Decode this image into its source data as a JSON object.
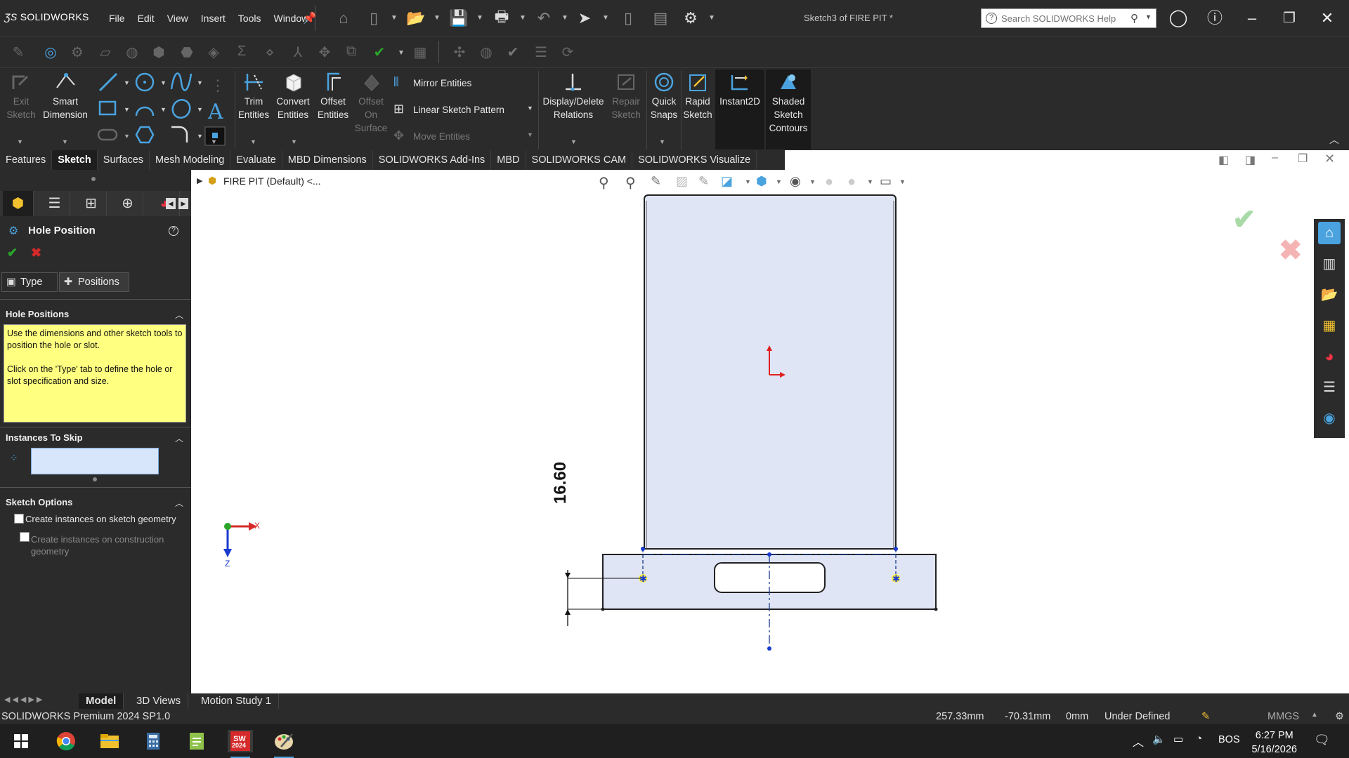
{
  "app": {
    "logo_brand": "SOLIDWORKS",
    "menus": [
      "File",
      "Edit",
      "View",
      "Insert",
      "Tools",
      "Window"
    ],
    "document_title": "Sketch3 of FIRE PIT *",
    "search_placeholder": "Search SOLIDWORKS Help"
  },
  "ribbon": {
    "exit_sketch": [
      "Exit",
      "Sketch"
    ],
    "smart_dimension": [
      "Smart",
      "Dimension"
    ],
    "trim_entities": [
      "Trim",
      "Entities"
    ],
    "convert_entities": [
      "Convert",
      "Entities"
    ],
    "offset_entities": [
      "Offset",
      "Entities"
    ],
    "offset_on_surface": [
      "Offset",
      "On",
      "Surface"
    ],
    "mirror_entities": "Mirror Entities",
    "linear_sketch_pattern": "Linear Sketch Pattern",
    "move_entities": "Move Entities",
    "display_delete_relations": [
      "Display/Delete",
      "Relations"
    ],
    "repair_sketch": [
      "Repair",
      "Sketch"
    ],
    "quick_snaps": [
      "Quick",
      "Snaps"
    ],
    "rapid_sketch": [
      "Rapid",
      "Sketch"
    ],
    "instant2d": "Instant2D",
    "shaded_sketch_contours": [
      "Shaded",
      "Sketch",
      "Contours"
    ]
  },
  "command_tabs": [
    "Features",
    "Sketch",
    "Surfaces",
    "Mesh Modeling",
    "Evaluate",
    "MBD Dimensions",
    "SOLIDWORKS Add-Ins",
    "MBD",
    "SOLIDWORKS CAM",
    "SOLIDWORKS Visualize"
  ],
  "active_tab": "Sketch",
  "property_manager": {
    "title": "Hole Position",
    "help": "?",
    "tab_type": "Type",
    "tab_positions": "Positions",
    "hole_positions_header": "Hole Positions",
    "hint_line1": "Use the dimensions and other sketch tools to position the hole or slot.",
    "hint_line2": "Click on the 'Type' tab to define the hole or slot specification and size.",
    "instances_to_skip_header": "Instances To Skip",
    "sketch_options_header": "Sketch Options",
    "opt_sketch_geometry": "Create instances on sketch geometry",
    "opt_construction_geometry_1": "Create instances on construction",
    "opt_construction_geometry_2": "geometry"
  },
  "feature_tree": {
    "root": "FIRE PIT  (Default) <..."
  },
  "drawing": {
    "dimension_value": "16.60",
    "triad_x": "X",
    "triad_z": "Z"
  },
  "bottom_tabs": [
    "Model",
    "3D Views",
    "Motion Study 1"
  ],
  "status": {
    "product": "SOLIDWORKS Premium 2024 SP1.0",
    "x": "257.33mm",
    "y": "-70.31mm",
    "z": "0mm",
    "state": "Under Defined",
    "units": "MMGS"
  },
  "taskbar": {
    "time": "6:27 PM",
    "date": "5/16/2026",
    "lang": "BOS",
    "sw_year": "2024"
  },
  "colors": {
    "accent_blue": "#1a5fb4",
    "sketch_fill": "#e0e5f6",
    "hint_yellow": "#ffff80",
    "ok_green": "#2aa52a",
    "cancel_red": "#d62a2a"
  }
}
